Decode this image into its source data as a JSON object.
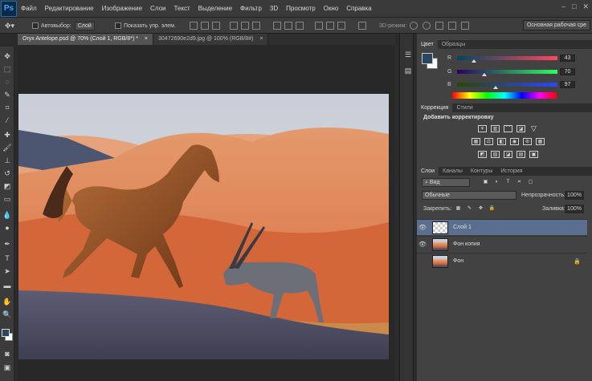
{
  "app": {
    "logo": "Ps"
  },
  "menu": [
    "Файл",
    "Редактирование",
    "Изображение",
    "Слои",
    "Текст",
    "Выделение",
    "Фильтр",
    "3D",
    "Просмотр",
    "Окно",
    "Справка"
  ],
  "window_controls": [
    "–",
    "□",
    "✕"
  ],
  "options_bar": {
    "autoselect_label": "Автовыбор:",
    "autoselect_value": "Слой",
    "show_controls_label": "Показать упр. элем.",
    "mode_3d_label": "3D-режим:",
    "workspace": "Основная рабочая сре"
  },
  "doc_tabs": [
    {
      "label": "Oryx Antelope.psd @ 70% (Слой 1, RGB/8*) *",
      "close": "×"
    },
    {
      "label": "30472690e2d9.jpg @ 100% (RGB/8#)",
      "close": "×"
    }
  ],
  "color_panel": {
    "tabs": [
      "Цвет",
      "Образцы"
    ],
    "channels": [
      {
        "label": "R",
        "value": "43",
        "fraction": 0.17
      },
      {
        "label": "G",
        "value": "70",
        "fraction": 0.27
      },
      {
        "label": "B",
        "value": "97",
        "fraction": 0.38
      }
    ],
    "fg_color": "#2b4661",
    "bg_color": "#ffffff"
  },
  "adjustments_panel": {
    "tabs": [
      "Коррекция",
      "Стили"
    ],
    "title": "Добавить корректировку",
    "icons_row1": [
      "brightness-icon",
      "levels-icon",
      "curves-icon",
      "exposure-icon",
      "vibrance-icon"
    ],
    "icons_row2": [
      "hue-sat-icon",
      "color-balance-icon",
      "bw-icon",
      "photo-filter-icon",
      "channel-mixer-icon",
      "color-lookup-icon"
    ],
    "icons_row3": [
      "invert-icon",
      "posterize-icon",
      "threshold-icon",
      "gradient-map-icon",
      "selective-color-icon"
    ]
  },
  "layers_panel": {
    "tabs": [
      "Слои",
      "Каналы",
      "Контуры",
      "История"
    ],
    "filter_kind": "Вид",
    "blend_mode": "Обычные",
    "opacity_label": "Непрозрачность:",
    "opacity_value": "100%",
    "lock_label": "Закрепить:",
    "fill_label": "Заливка:",
    "fill_value": "100%",
    "layers": [
      {
        "name": "Слой 1",
        "visible": true,
        "selected": true
      },
      {
        "name": "Фон копия",
        "visible": true,
        "selected": false
      },
      {
        "name": "Фон",
        "visible": false,
        "selected": false,
        "locked": true
      }
    ]
  },
  "colors": {
    "accent": "#33a6ff",
    "selected_layer": "#5a6f8f"
  }
}
